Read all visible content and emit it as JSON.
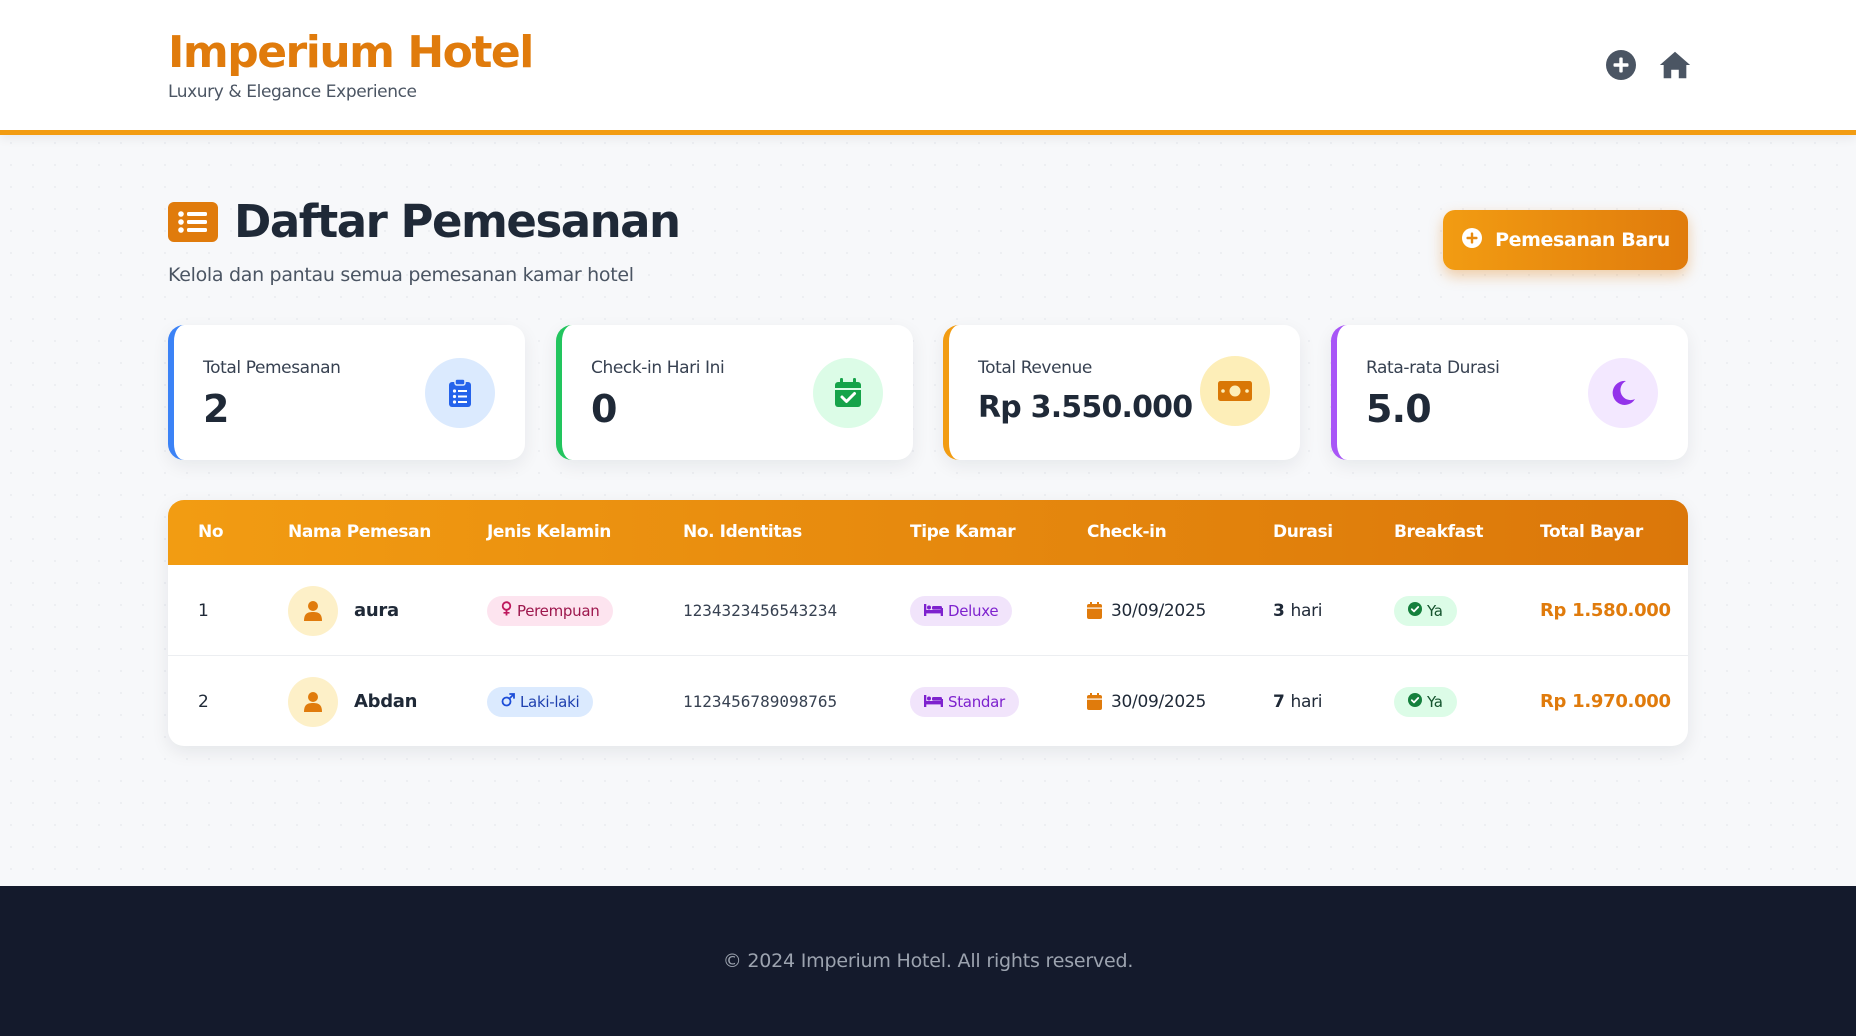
{
  "header": {
    "title": "Imperium Hotel",
    "subtitle": "Luxury & Elegance Experience",
    "icons": [
      "plus-circle-icon",
      "home-icon"
    ]
  },
  "page": {
    "title": "Daftar Pemesanan",
    "subtitle": "Kelola dan pantau semua pemesanan kamar hotel",
    "new_button": "Pemesanan Baru"
  },
  "stats": [
    {
      "label": "Total Pemesanan",
      "value": "2",
      "icon": "clipboard-list-icon",
      "accent": "#3b82f6"
    },
    {
      "label": "Check-in Hari Ini",
      "value": "0",
      "icon": "calendar-check-icon",
      "accent": "#22c55e"
    },
    {
      "label": "Total Revenue",
      "value": "Rp 3.550.000",
      "icon": "money-bill-icon",
      "accent": "#f29c12"
    },
    {
      "label": "Rata-rata Durasi",
      "value": "5.0",
      "icon": "moon-icon",
      "accent": "#a855f7"
    }
  ],
  "table": {
    "columns": [
      "No",
      "Nama Pemesan",
      "Jenis Kelamin",
      "No. Identitas",
      "Tipe Kamar",
      "Check-in",
      "Durasi",
      "Breakfast",
      "Total Bayar"
    ],
    "rows": [
      {
        "no": "1",
        "name": "aura",
        "gender": "Perempuan",
        "identity": "1234323456543234",
        "room": "Deluxe",
        "checkin": "30/09/2025",
        "duration_num": "3",
        "duration_unit": "hari",
        "breakfast": "Ya",
        "total": "Rp 1.580.000"
      },
      {
        "no": "2",
        "name": "Abdan",
        "gender": "Laki-laki",
        "identity": "1123456789098765",
        "room": "Standar",
        "checkin": "30/09/2025",
        "duration_num": "7",
        "duration_unit": "hari",
        "breakfast": "Ya",
        "total": "Rp 1.970.000"
      }
    ]
  },
  "footer": {
    "text": "© 2024 Imperium Hotel. All rights reserved."
  },
  "colors": {
    "brand": "#e07b0c",
    "brand_light": "#f29c12",
    "footer_bg": "#141a2c"
  }
}
